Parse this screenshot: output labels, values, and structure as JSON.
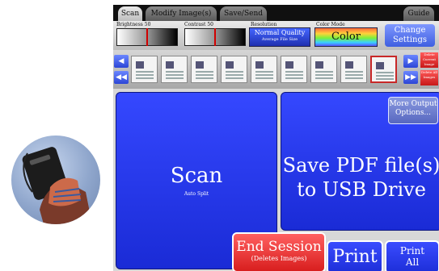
{
  "tabs": [
    {
      "label": "Scan",
      "active": true
    },
    {
      "label": "Modify Image(s)",
      "active": false
    },
    {
      "label": "Save/Send",
      "active": false
    },
    {
      "label": "Guide",
      "active": false
    }
  ],
  "controls": {
    "brightness_label": "Brightness 50",
    "contrast_label": "Contrast 50",
    "resolution_label": "Resolution",
    "resolution_value": "Normal Quality",
    "resolution_sub": "Average File Size",
    "colormode_label": "Color Mode",
    "colormode_value": "Color",
    "change_settings": "Change Settings",
    "brightness": 50,
    "contrast": 50
  },
  "thumbnails": {
    "count": 9,
    "selected_index": 8,
    "delete_current": "Delete Current Image",
    "delete_all": "Delete All Images"
  },
  "main": {
    "scan_label": "Scan",
    "scan_sub": "Auto Split",
    "more_output": "More Output Options...",
    "save_pdf_line1": "Save PDF file(s)",
    "save_pdf_line2": "to USB Drive",
    "end_session": "End Session",
    "end_session_sub": "(Deletes Images)",
    "print": "Print",
    "print_all_line1": "Print",
    "print_all_line2": "All"
  },
  "colors": {
    "accent_blue": "#2233ee",
    "end_red": "#e02626"
  }
}
